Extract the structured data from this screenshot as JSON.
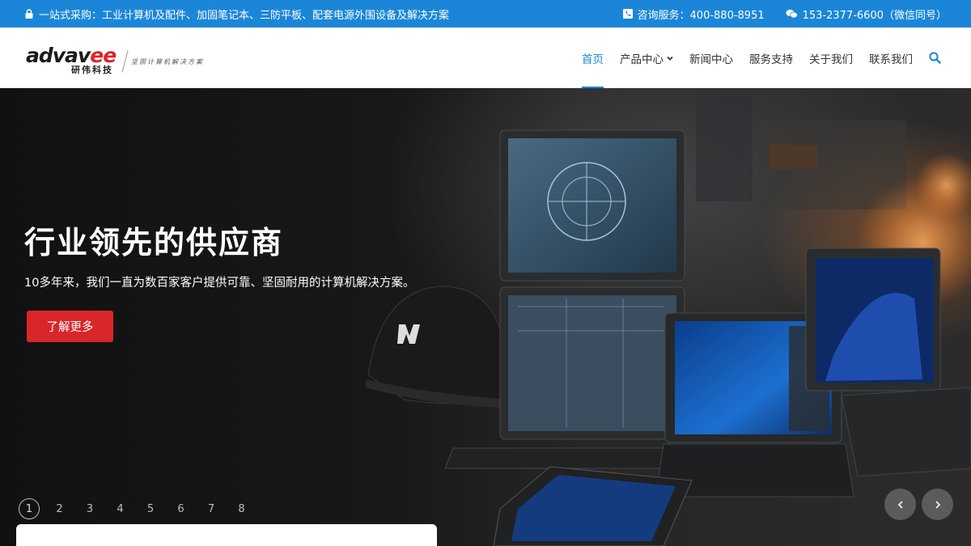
{
  "topbar": {
    "left_text": "一站式采购：工业计算机及配件、加固笔记本、三防平板、配套电源外围设备及解决方案",
    "hotline": "咨询服务：400-880-8951",
    "mobile": "153-2377-6600（微信同号）",
    "left_icon": "lock-icon",
    "phone_icon": "phone-square-icon",
    "wechat_icon": "wechat-icon"
  },
  "logo": {
    "brand": "advav",
    "brand_accent": "ee",
    "cn_name": "研伟科技",
    "slogan": "坚固计算机解决方案"
  },
  "nav": {
    "items": [
      {
        "label": "首页",
        "active": true
      },
      {
        "label": "产品中心",
        "has_dropdown": true
      },
      {
        "label": "新闻中心"
      },
      {
        "label": "服务支持"
      },
      {
        "label": "关于我们"
      },
      {
        "label": "联系我们"
      }
    ],
    "search_icon": "search-icon"
  },
  "hero": {
    "title": "行业领先的供应商",
    "subtitle": "10多年来，我们一直为数百家客户提供可靠、坚固耐用的计算机解决方案。",
    "button_label": "了解更多",
    "pages": [
      "1",
      "2",
      "3",
      "4",
      "5",
      "6",
      "7",
      "8"
    ],
    "active_page": "1",
    "prev_icon": "chevron-left-icon",
    "next_icon": "chevron-right-icon"
  },
  "colors": {
    "accent": "#1b86d8",
    "cta": "#d8262a",
    "topbar_bg": "#1b86d8"
  }
}
